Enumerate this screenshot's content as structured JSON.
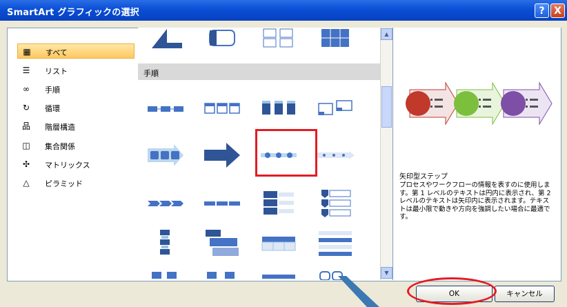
{
  "window": {
    "title": "SmartArt グラフィックの選択",
    "help_label": "?",
    "close_label": "X"
  },
  "categories": [
    {
      "icon": "all-icon",
      "label": "すべて",
      "selected": true
    },
    {
      "icon": "list-icon",
      "label": "リスト"
    },
    {
      "icon": "process-icon",
      "label": "手順"
    },
    {
      "icon": "cycle-icon",
      "label": "循環"
    },
    {
      "icon": "hierarchy-icon",
      "label": "階層構造"
    },
    {
      "icon": "relationship-icon",
      "label": "集合関係"
    },
    {
      "icon": "matrix-icon",
      "label": "マトリックス"
    },
    {
      "icon": "pyramid-icon",
      "label": "ピラミッド"
    }
  ],
  "gallery": {
    "section_label": "手順"
  },
  "preview": {
    "title": "矢印型ステップ",
    "description": "プロセスやワークフローの情報を表すのに使用します。第 1 レベルのテキストは円内に表示され、第 2 レベルのテキストは矢印内に表示されます。テキストは最小限で動きや方向を強調したい場合に最適です。"
  },
  "buttons": {
    "ok": "OK",
    "cancel": "キャンセル"
  },
  "colors": {
    "accent_red": "#e31b23",
    "title_blue": "#0a4fd6",
    "thumb_blue": "#4472c4",
    "preview_red": "#c0392b",
    "preview_green": "#7bbf3d",
    "preview_purple": "#7d4fa6"
  }
}
